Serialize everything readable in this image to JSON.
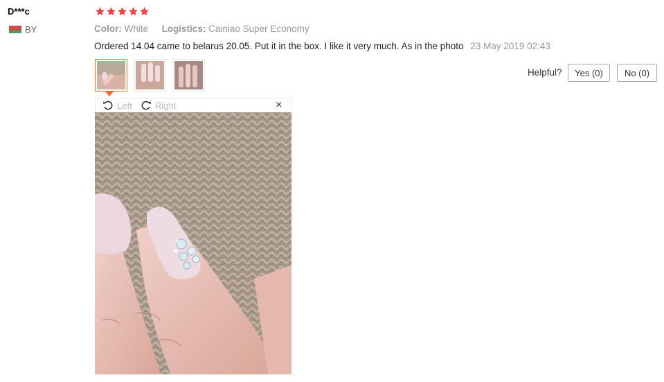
{
  "user": {
    "name": "D***c",
    "country": "BY",
    "flag_icon": "belarus-flag-icon"
  },
  "rating": {
    "stars": 5,
    "max": 5,
    "color": "#e8464b"
  },
  "meta": {
    "color_label": "Color:",
    "color_value": "White",
    "logistics_label": "Logistics:",
    "logistics_value": "Cainiao Super Economy"
  },
  "review": {
    "text": "Ordered 14.04 came to belarus 20.05. Put it in the box. I like it very much. As in the photo",
    "date": "23 May 2019 02:43"
  },
  "thumbnails": [
    {
      "alt": "photo-1",
      "selected": true
    },
    {
      "alt": "photo-2",
      "selected": false
    },
    {
      "alt": "photo-3",
      "selected": false
    }
  ],
  "viewer": {
    "rotate_left": "Left",
    "rotate_right": "Right",
    "close": "×"
  },
  "helpful": {
    "label": "Helpful?",
    "yes": "Yes (0)",
    "no": "No (0)"
  },
  "colors": {
    "accent": "#f06b2a",
    "muted": "#999999"
  }
}
